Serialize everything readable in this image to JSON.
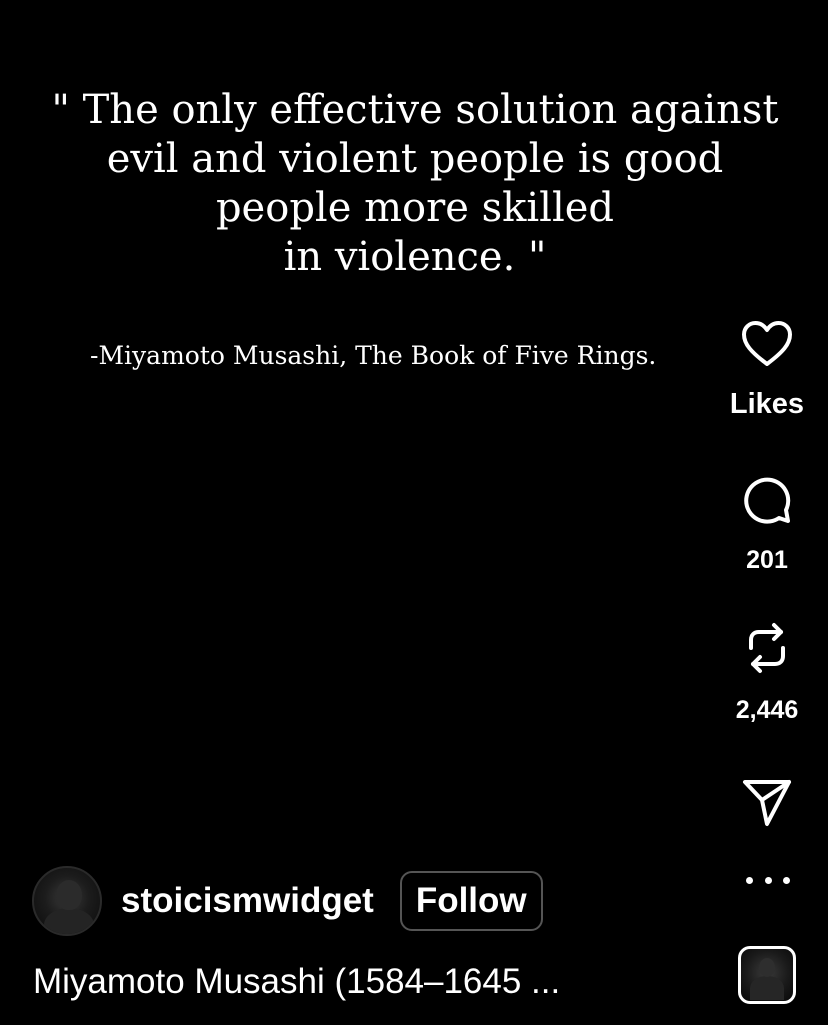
{
  "post": {
    "quote_lines": [
      "\" The only effective solution against",
      "evil and violent people is good",
      "people more skilled",
      "in violence. \""
    ],
    "attribution": "-Miyamoto Musashi, The Book of Five Rings."
  },
  "actions": {
    "likes": {
      "icon": "heart-icon",
      "label": "Likes"
    },
    "comments": {
      "icon": "comment-icon",
      "count": "201"
    },
    "reposts": {
      "icon": "repost-icon",
      "count": "2,446"
    },
    "share": {
      "icon": "send-icon"
    },
    "more": {
      "icon": "more-options-icon"
    }
  },
  "author": {
    "username": "stoicismwidget",
    "follow_label": "Follow"
  },
  "caption": {
    "text": "Miyamoto Musashi (1584–1645 ..."
  },
  "colors": {
    "background": "#000000",
    "text": "#ffffff",
    "button_border": "#555555"
  }
}
